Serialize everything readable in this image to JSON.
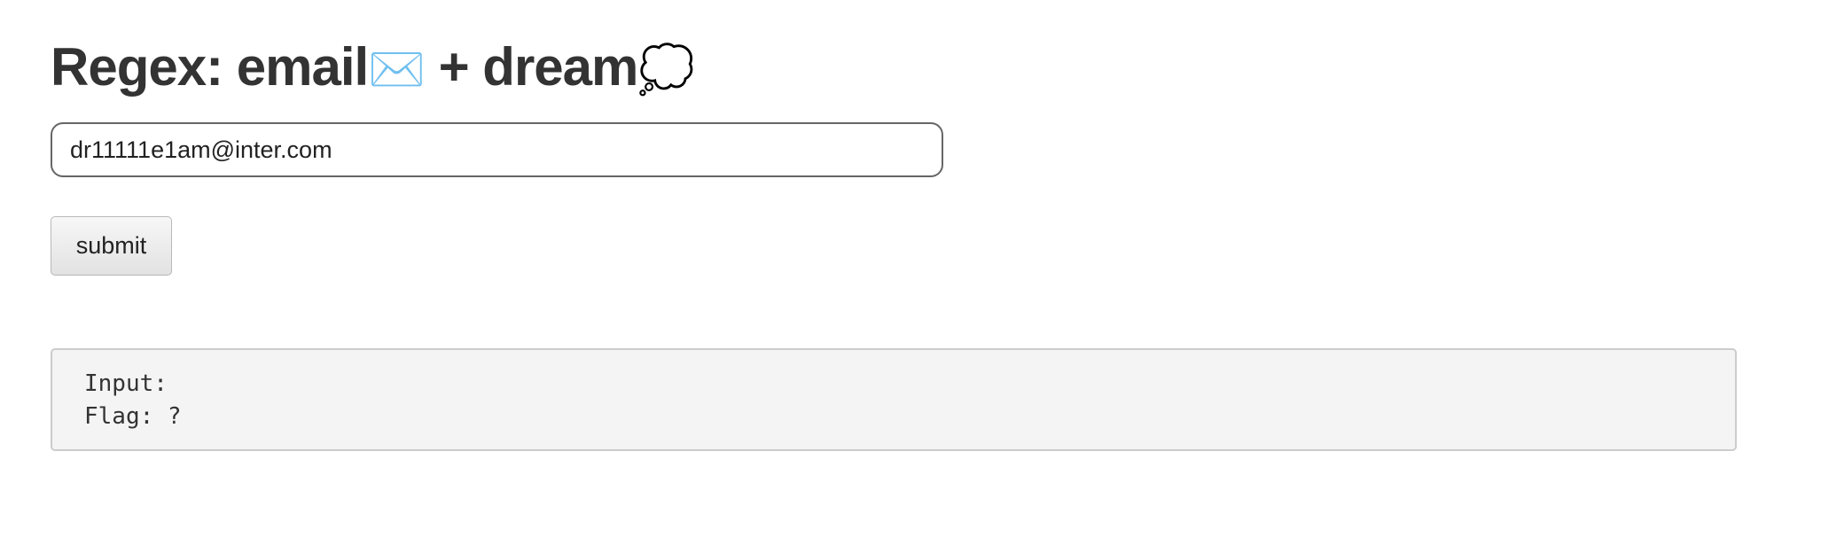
{
  "header": {
    "title_text": "Regex: email",
    "email_emoji": "✉️",
    "title_mid": " + dream",
    "dream_emoji": "💭"
  },
  "form": {
    "email_value": "dr11111e1am@inter.com",
    "submit_label": "submit"
  },
  "output": {
    "input_line": "Input:",
    "flag_line": "Flag: ?"
  }
}
